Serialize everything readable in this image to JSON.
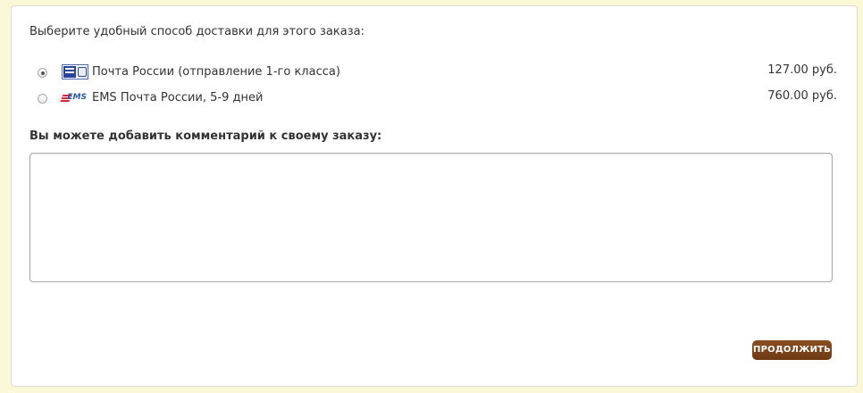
{
  "intro_text": "Выберите удобный способ доставки для этого заказа:",
  "shipping_methods": [
    {
      "name": "Почта России (отправление 1-го класса)",
      "price": "127.00 руб.",
      "selected": true,
      "icon": "russian-post-logo-icon"
    },
    {
      "name": "EMS Почта России, 5-9 дней",
      "price": "760.00 руб.",
      "selected": false,
      "icon": "ems-logo-icon",
      "logo_text": "EMS"
    }
  ],
  "comment": {
    "label": "Вы можете добавить комментарий к своему заказу:",
    "value": ""
  },
  "continue_button": {
    "label": "ПРОДОЛЖИТЬ",
    "color": "#7a4219"
  },
  "colors": {
    "page_background": "#fbf8d8",
    "panel_background": "#ffffff"
  }
}
